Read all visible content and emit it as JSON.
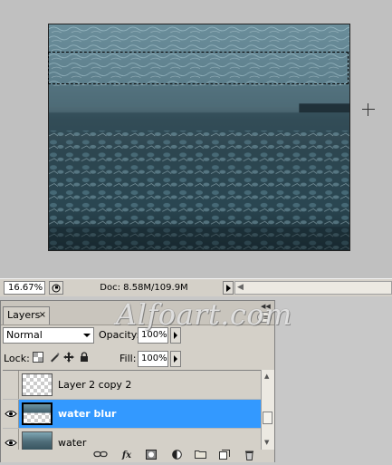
{
  "status_bar": {
    "zoom": "16.67%",
    "doc_size": "Doc: 8.58M/109.9M"
  },
  "watermark": "Alfoart.com",
  "layers_panel": {
    "tab_label": "Layers",
    "tab_close": "×",
    "blend_mode": "Normal",
    "opacity_label": "Opacity:",
    "opacity_value": "100%",
    "lock_label": "Lock:",
    "fill_label": "Fill:",
    "fill_value": "100%",
    "layers": [
      {
        "name": "Layer 2 copy 2",
        "visible": false,
        "selected": false,
        "thumb": "checker"
      },
      {
        "name": "water blur",
        "visible": true,
        "selected": true,
        "thumb": "half"
      },
      {
        "name": "water",
        "visible": true,
        "selected": false,
        "thumb": "water"
      }
    ],
    "toolbar_icons": [
      "link-icon",
      "fx-icon",
      "mask-icon",
      "adjustment-icon",
      "folder-icon",
      "new-layer-icon",
      "trash-icon"
    ]
  },
  "colors": {
    "selection_highlight": "#3399ff",
    "panel_bg": "#d4d0c8",
    "canvas_bg": "#c0c0c0"
  }
}
